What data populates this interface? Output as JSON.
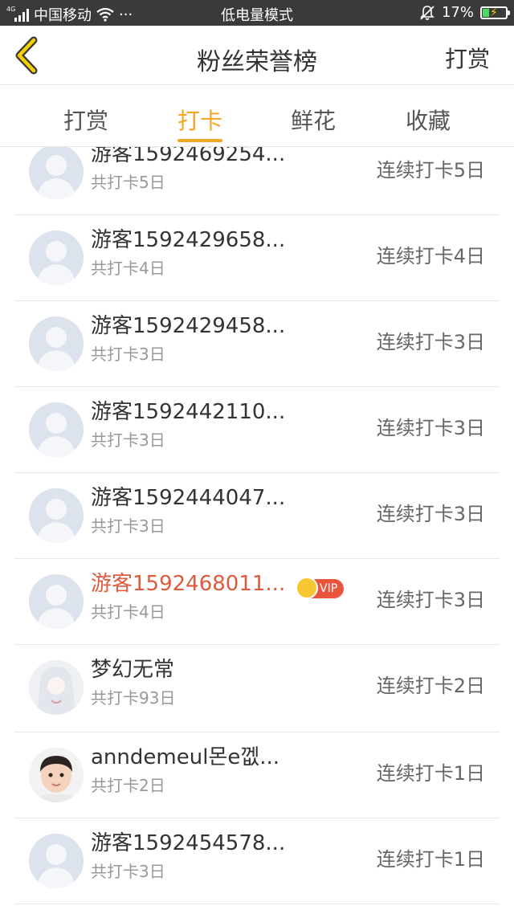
{
  "status_bar": {
    "network": "4G",
    "carrier": "中国移动",
    "dots": "···",
    "mode": "低电量模式",
    "battery": "17%",
    "icons": [
      "signal-icon",
      "wifi-icon",
      "mute-bell-icon",
      "battery-charging-icon"
    ]
  },
  "header": {
    "title": "粉丝荣誉榜",
    "action": "打赏",
    "back_icon": "chevron-left-icon",
    "accent_color": "#f5a623"
  },
  "tabs": [
    {
      "label": "打赏",
      "active": false
    },
    {
      "label": "打卡",
      "active": true
    },
    {
      "label": "鲜花",
      "active": false
    },
    {
      "label": "收藏",
      "active": false
    }
  ],
  "list": [
    {
      "name": "游客1592469254...",
      "total": "共打卡5日",
      "streak": "连续打卡5日",
      "avatar": "default-avatar"
    },
    {
      "name": "游客1592429658...",
      "total": "共打卡4日",
      "streak": "连续打卡4日",
      "avatar": "default-avatar"
    },
    {
      "name": "游客1592429458...",
      "total": "共打卡3日",
      "streak": "连续打卡3日",
      "avatar": "default-avatar"
    },
    {
      "name": "游客1592442110...",
      "total": "共打卡3日",
      "streak": "连续打卡3日",
      "avatar": "default-avatar"
    },
    {
      "name": "游客1592444047...",
      "total": "共打卡3日",
      "streak": "连续打卡3日",
      "avatar": "default-avatar"
    },
    {
      "name": "游客1592468011...",
      "total": "共打卡4日",
      "streak": "连续打卡3日",
      "avatar": "default-avatar",
      "vip": "VIP",
      "highlight": true
    },
    {
      "name": "梦幻无常",
      "total": "共打卡93日",
      "streak": "连续打卡2日",
      "avatar": "anime-avatar"
    },
    {
      "name": "anndemeul몬e껪...",
      "total": "共打卡2日",
      "streak": "连续打卡1日",
      "avatar": "child-photo-avatar"
    },
    {
      "name": "游客1592454578...",
      "total": "共打卡3日",
      "streak": "连续打卡1日",
      "avatar": "default-avatar"
    }
  ]
}
